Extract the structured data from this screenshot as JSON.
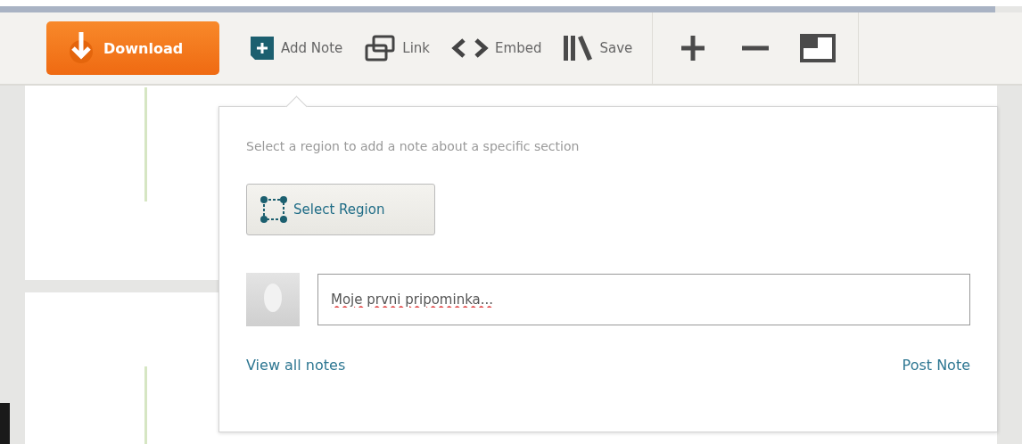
{
  "toolbar": {
    "download": {
      "label": "Download"
    },
    "items": [
      {
        "kind": "add-note",
        "label": "Add Note"
      },
      {
        "kind": "link",
        "label": "Link"
      },
      {
        "kind": "embed",
        "label": "Embed"
      },
      {
        "kind": "save",
        "label": "Save"
      }
    ],
    "zoom": [
      {
        "kind": "zoom-in"
      },
      {
        "kind": "zoom-out"
      },
      {
        "kind": "fit"
      }
    ]
  },
  "note_popover": {
    "hint": "Select a region to add a note about a specific section",
    "select_region_button": "Select Region",
    "note_input": {
      "value": "Moje prvni pripominka..."
    },
    "view_all_link": "View all notes",
    "post_button": "Post Note"
  }
}
